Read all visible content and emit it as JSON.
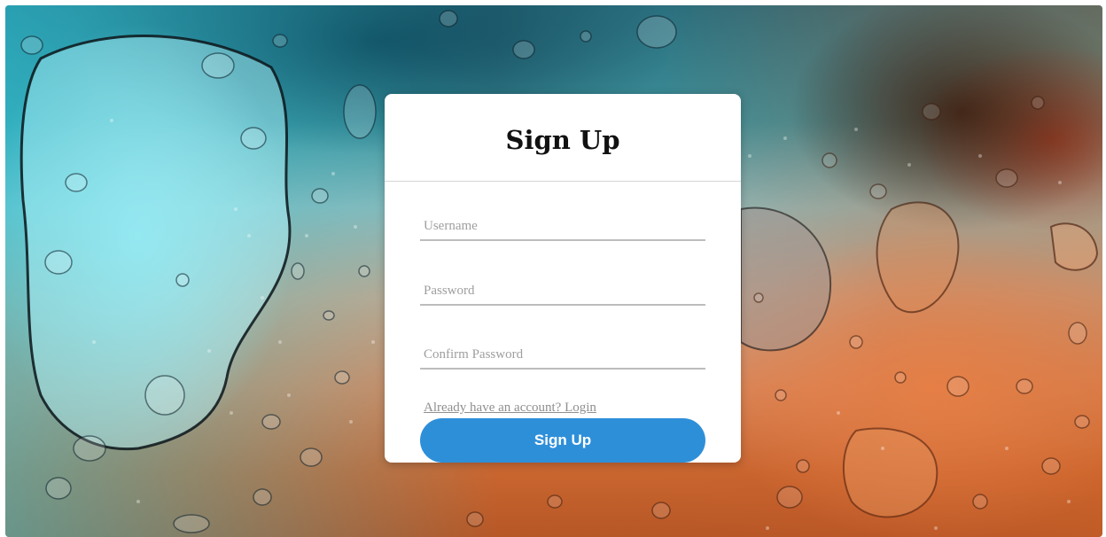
{
  "form": {
    "title": "Sign Up",
    "username_placeholder": "Username",
    "password_placeholder": "Password",
    "confirm_password_placeholder": "Confirm Password",
    "login_link_label": "Already have an account? Login",
    "submit_label": "Sign Up"
  },
  "colors": {
    "button_bg": "#2e8fd9",
    "card_bg": "#ffffff",
    "field_underline": "#bdbdbd",
    "link_text": "#8f8f8f"
  },
  "background": {
    "description_icon": "water-droplets-image"
  }
}
